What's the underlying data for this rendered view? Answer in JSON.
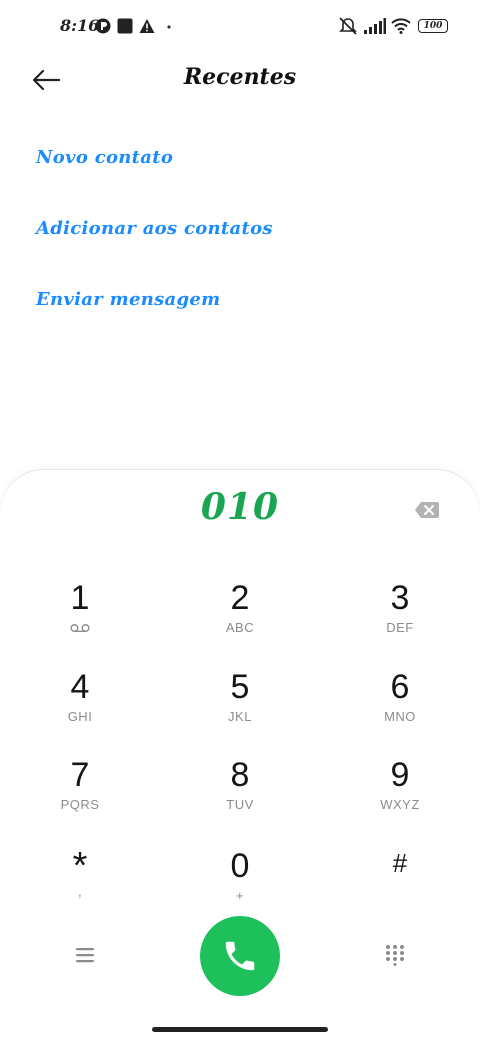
{
  "status_bar": {
    "time": "8:16",
    "battery": "100",
    "icons": [
      "app-notification-icon",
      "square-notification-icon",
      "warning-icon",
      "dot-icon",
      "muted-icon",
      "signal-icon",
      "wifi-icon",
      "battery-icon"
    ]
  },
  "header": {
    "title": "Recentes",
    "back_icon": "arrow-left-icon"
  },
  "actions": [
    {
      "label": "Novo contato"
    },
    {
      "label": "Adicionar aos contatos"
    },
    {
      "label": "Enviar mensagem"
    }
  ],
  "dialer": {
    "number": "010",
    "backspace_icon": "backspace-icon",
    "keys": [
      {
        "digit": "1",
        "letters": "",
        "sub_icon": "voicemail-icon"
      },
      {
        "digit": "2",
        "letters": "ABC"
      },
      {
        "digit": "3",
        "letters": "DEF"
      },
      {
        "digit": "4",
        "letters": "GHI"
      },
      {
        "digit": "5",
        "letters": "JKL"
      },
      {
        "digit": "6",
        "letters": "MNO"
      },
      {
        "digit": "7",
        "letters": "PQRS"
      },
      {
        "digit": "8",
        "letters": "TUV"
      },
      {
        "digit": "9",
        "letters": "WXYZ"
      },
      {
        "digit": "*",
        "letters": ","
      },
      {
        "digit": "0",
        "letters": "+"
      },
      {
        "digit": "#",
        "letters": ""
      }
    ],
    "bottom": {
      "menu_icon": "menu-icon",
      "call_icon": "phone-icon",
      "keypad_icon": "dialpad-icon"
    },
    "colors": {
      "accent_green": "#1ec05c",
      "number_green": "#1aa552",
      "link_blue": "#1a8cff"
    }
  }
}
